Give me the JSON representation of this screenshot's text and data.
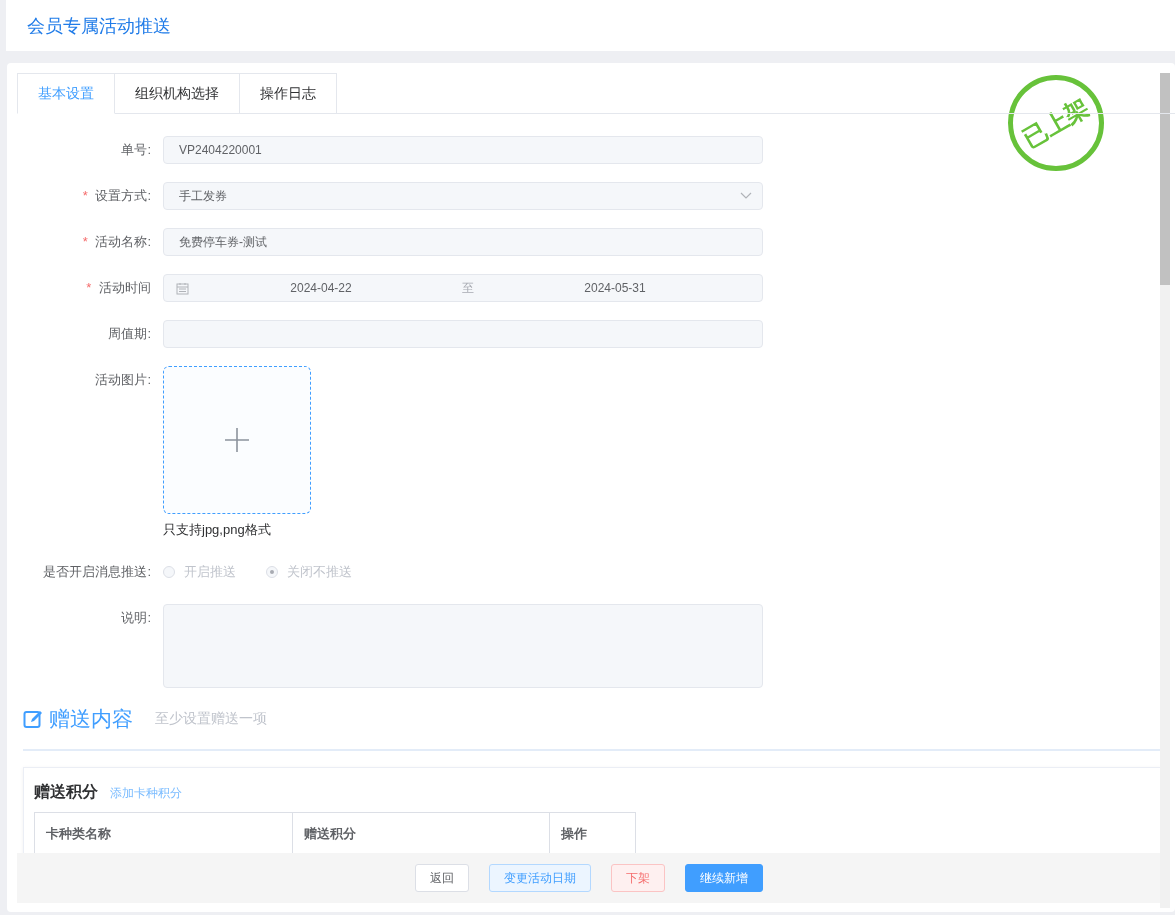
{
  "page_title": "会员专属活动推送",
  "tabs": [
    {
      "label": "基本设置",
      "selected": true
    },
    {
      "label": "组织机构选择",
      "selected": false
    },
    {
      "label": "操作日志",
      "selected": false
    }
  ],
  "stamp": {
    "text": "已上架"
  },
  "required_mark": "*",
  "form": [
    {
      "label": "单号:",
      "required": false,
      "kind": "text",
      "value": "VP2404220001"
    },
    {
      "label": "设置方式:",
      "required": true,
      "kind": "select",
      "value": "手工发券"
    },
    {
      "label": "活动名称:",
      "required": true,
      "kind": "text",
      "value": "免费停车券-测试"
    },
    {
      "label": "活动时间",
      "required": true,
      "kind": "daterange",
      "start": "2024-04-22",
      "separator": "至",
      "end": "2024-05-31"
    },
    {
      "label": "周值期:",
      "required": false,
      "kind": "text"
    },
    {
      "label": "活动图片:",
      "required": false,
      "kind": "upload",
      "hint": "只支持jpg,png格式"
    },
    {
      "label": "是否开启消息推送:",
      "required": false,
      "kind": "radio",
      "disabled": true,
      "options": [
        {
          "label": "开启推送",
          "selected": false
        },
        {
          "label": "关闭不推送",
          "selected": true
        }
      ]
    },
    {
      "label": "说明:",
      "required": false,
      "kind": "textarea"
    }
  ],
  "section": {
    "title": "赠送内容",
    "note": "至少设置赠送一项"
  },
  "points_card": {
    "title": "赠送积分",
    "link": "添加卡种积分",
    "columns": [
      "卡种类名称",
      "赠送积分",
      "操作"
    ]
  },
  "buttons": [
    {
      "label": "返回",
      "kind": "default"
    },
    {
      "label": "变更活动日期",
      "kind": "primary-plain"
    },
    {
      "label": "下架",
      "kind": "danger-plain"
    },
    {
      "label": "继续新增",
      "kind": "primary"
    }
  ]
}
